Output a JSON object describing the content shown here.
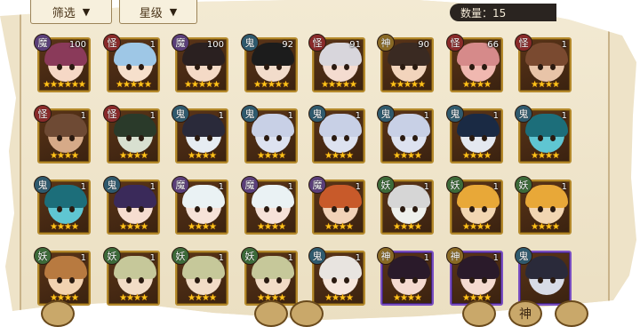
{
  "filters": [
    {
      "label": "筛选",
      "name": "filter-type-dropdown"
    },
    {
      "label": "星级",
      "name": "filter-star-dropdown"
    }
  ],
  "count_label": "数量：15",
  "cards": [
    {
      "type": "魔",
      "level": "100",
      "stars": "★★★★★★",
      "rarity": "sp",
      "hair": "#8a3a5a",
      "skin": "#f6d8c6"
    },
    {
      "type": "怪",
      "level": "1",
      "stars": "★★★★★",
      "rarity": "sr",
      "hair": "#9ec7e6",
      "skin": "#f6e0cc"
    },
    {
      "type": "魔",
      "level": "100",
      "stars": "★★★★★",
      "rarity": "sr",
      "hair": "#2a2020",
      "skin": "#f4dac6"
    },
    {
      "type": "鬼",
      "level": "92",
      "stars": "★★★★★",
      "rarity": "sr",
      "hair": "#1c1c1c",
      "skin": "#f2dccb"
    },
    {
      "type": "怪",
      "level": "91",
      "stars": "★★★★★",
      "rarity": "sr",
      "hair": "#d8d6dc",
      "skin": "#f4dcd0"
    },
    {
      "type": "神",
      "level": "90",
      "stars": "★★★★★",
      "rarity": "sr",
      "hair": "#3a2a22",
      "skin": "#f2d4bc"
    },
    {
      "type": "怪",
      "level": "66",
      "stars": "★★★★",
      "rarity": "sr",
      "hair": "#d68a8a",
      "skin": "#f0b8b0"
    },
    {
      "type": "怪",
      "level": "1",
      "stars": "★★★★",
      "rarity": "sr",
      "hair": "#7a4a30",
      "skin": "#e8c4a8"
    },
    {
      "type": "怪",
      "level": "1",
      "stars": "★★★★",
      "rarity": "sr",
      "hair": "#6e4a34",
      "skin": "#d6aa88"
    },
    {
      "type": "怪",
      "level": "1",
      "stars": "★★★★",
      "rarity": "sr",
      "hair": "#2a3a2a",
      "skin": "#d8e0d0"
    },
    {
      "type": "鬼",
      "level": "1",
      "stars": "★★★★",
      "rarity": "sr",
      "hair": "#2a2a3a",
      "skin": "#e6ecf2"
    },
    {
      "type": "鬼",
      "level": "1",
      "stars": "★★★★",
      "rarity": "sr",
      "hair": "#c8d0e6",
      "skin": "#dde2f0"
    },
    {
      "type": "鬼",
      "level": "1",
      "stars": "★★★★",
      "rarity": "sr",
      "hair": "#c8d0e6",
      "skin": "#dde2f0"
    },
    {
      "type": "鬼",
      "level": "1",
      "stars": "★★★★",
      "rarity": "sr",
      "hair": "#c8d0e6",
      "skin": "#dde2f0"
    },
    {
      "type": "鬼",
      "level": "1",
      "stars": "★★★★",
      "rarity": "sr",
      "hair": "#1a2a44",
      "skin": "#e4e8f0"
    },
    {
      "type": "鬼",
      "level": "1",
      "stars": "★★★★",
      "rarity": "sr",
      "hair": "#1c6e7a",
      "skin": "#5fc6d2"
    },
    {
      "type": "鬼",
      "level": "1",
      "stars": "★★★★",
      "rarity": "sr",
      "hair": "#1c6e7a",
      "skin": "#5fc6d2"
    },
    {
      "type": "鬼",
      "level": "1",
      "stars": "★★★★",
      "rarity": "sr",
      "hair": "#3a2a5a",
      "skin": "#f6ddd0"
    },
    {
      "type": "魔",
      "level": "1",
      "stars": "★★★★",
      "rarity": "sr",
      "hair": "#eaf2f4",
      "skin": "#f6e2d8"
    },
    {
      "type": "魔",
      "level": "1",
      "stars": "★★★★",
      "rarity": "sr",
      "hair": "#eaf2f4",
      "skin": "#f6e2d8"
    },
    {
      "type": "魔",
      "level": "1",
      "stars": "★★★★",
      "rarity": "sr",
      "hair": "#c85a2a",
      "skin": "#f2d2b8"
    },
    {
      "type": "妖",
      "level": "1",
      "stars": "★★★★",
      "rarity": "sr",
      "hair": "#d6d6d6",
      "skin": "#eef0ec"
    },
    {
      "type": "妖",
      "level": "1",
      "stars": "★★★★",
      "rarity": "sr",
      "hair": "#e8a838",
      "skin": "#f2d6b2"
    },
    {
      "type": "妖",
      "level": "1",
      "stars": "★★★★",
      "rarity": "sr",
      "hair": "#e8a838",
      "skin": "#f2d6b2"
    },
    {
      "type": "妖",
      "level": "1",
      "stars": "★★★★",
      "rarity": "sr",
      "hair": "#b87a40",
      "skin": "#f2d2b0"
    },
    {
      "type": "妖",
      "level": "1",
      "stars": "★★★★",
      "rarity": "sr",
      "hair": "#c6c89a",
      "skin": "#f2dcc6"
    },
    {
      "type": "妖",
      "level": "1",
      "stars": "★★★★",
      "rarity": "sr",
      "hair": "#c6c89a",
      "skin": "#f2dcc6"
    },
    {
      "type": "妖",
      "level": "1",
      "stars": "★★★★",
      "rarity": "sr",
      "hair": "#c6c89a",
      "skin": "#f2dcc6"
    },
    {
      "type": "鬼",
      "level": "1",
      "stars": "★★★★",
      "rarity": "sr",
      "hair": "#e8e4e0",
      "skin": "#f6e6dc"
    },
    {
      "type": "神",
      "level": "1",
      "stars": "★★★★",
      "rarity": "ssr",
      "hair": "#2a1a2a",
      "skin": "#f4dad0"
    },
    {
      "type": "神",
      "level": "1",
      "stars": "★★★★",
      "rarity": "ssr",
      "hair": "#2a1a2a",
      "skin": "#f4dad0"
    },
    {
      "type": "鬼",
      "level": "",
      "stars": "",
      "rarity": "ssr",
      "hair": "#2a2a3a",
      "skin": "#d8dce6"
    }
  ],
  "bottom_buttons": [
    {
      "label": "",
      "name": "bottom-button-left"
    },
    {
      "label": "",
      "name": "bottom-button-mid-1"
    },
    {
      "label": "",
      "name": "bottom-button-mid-2"
    },
    {
      "label": "",
      "name": "bottom-button-right-1"
    },
    {
      "label": "神",
      "name": "bottom-button-shen"
    },
    {
      "label": "",
      "name": "bottom-button-right-3"
    }
  ]
}
